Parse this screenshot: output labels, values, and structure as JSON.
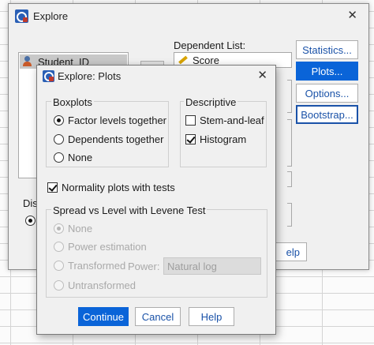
{
  "main_window": {
    "title": "Explore",
    "variable_list": {
      "items": [
        "Student_ID"
      ]
    },
    "dependent_list": {
      "label": "Dependent List:",
      "items": [
        "Score"
      ]
    },
    "buttons": {
      "statistics": "Statistics...",
      "plots": "Plots...",
      "options": "Options...",
      "bootstrap": "Bootstrap...",
      "help_partial": "elp"
    },
    "display_label_partial": "Dis"
  },
  "plots_dialog": {
    "title": "Explore: Plots",
    "boxplots": {
      "title": "Boxplots",
      "options": [
        "Factor levels together",
        "Dependents together",
        "None"
      ],
      "selected": "Factor levels together"
    },
    "descriptive": {
      "title": "Descriptive",
      "stem_and_leaf": {
        "label": "Stem-and-leaf",
        "checked": false
      },
      "histogram": {
        "label": "Histogram",
        "checked": true
      }
    },
    "normality": {
      "label": "Normality plots with tests",
      "checked": true
    },
    "spread_vs_level": {
      "title": "Spread vs Level with Levene Test",
      "options": [
        "None",
        "Power estimation",
        "Transformed",
        "Untransformed"
      ],
      "selected": "None",
      "enabled": false,
      "power": {
        "label": "Power:",
        "value": "Natural log"
      }
    },
    "buttons": {
      "continue": "Continue",
      "cancel": "Cancel",
      "help": "Help"
    }
  },
  "colors": {
    "accent": "#0a64d8",
    "link_text": "#1a52a8",
    "dialog_bg": "#f0f0f0",
    "disabled_text": "#a9a9a9"
  },
  "icons": {
    "app": "spss-app-icon",
    "close": "close-icon",
    "variable": "nominal-variable-icon",
    "dependent": "scale-variable-icon"
  }
}
